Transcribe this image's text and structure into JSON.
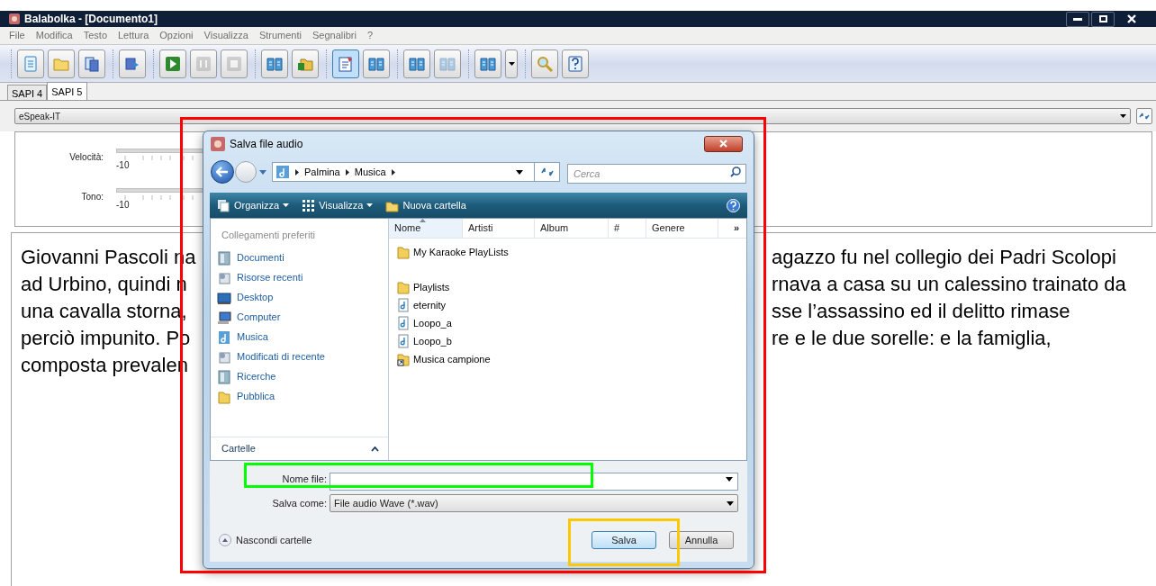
{
  "window": {
    "title": "Balabolka - [Documento1]"
  },
  "menu": [
    "File",
    "Modifica",
    "Testo",
    "Lettura",
    "Opzioni",
    "Visualizza",
    "Strumenti",
    "Segnalibri",
    "?"
  ],
  "toolbar": [
    [
      {
        "kind": "document",
        "pressed": false,
        "disabled": false
      },
      {
        "kind": "folder",
        "pressed": false,
        "disabled": false
      },
      {
        "kind": "pages",
        "pressed": false,
        "disabled": false
      }
    ],
    [
      {
        "kind": "export",
        "pressed": false,
        "disabled": false
      }
    ],
    [
      {
        "kind": "play",
        "pressed": false,
        "disabled": false
      },
      {
        "kind": "pause",
        "pressed": false,
        "disabled": true
      },
      {
        "kind": "stop",
        "pressed": false,
        "disabled": true
      }
    ],
    [
      {
        "kind": "book",
        "pressed": false,
        "disabled": false
      },
      {
        "kind": "folderbook",
        "pressed": false,
        "disabled": false
      }
    ],
    [
      {
        "kind": "clipboard",
        "pressed": true,
        "disabled": false
      },
      {
        "kind": "book",
        "pressed": false,
        "disabled": false
      }
    ],
    [
      {
        "kind": "book",
        "pressed": false,
        "disabled": false
      },
      {
        "kind": "book",
        "pressed": false,
        "disabled": true
      }
    ],
    [
      {
        "kind": "book",
        "pressed": false,
        "disabled": false
      },
      {
        "kind": "dropdown",
        "pressed": false,
        "disabled": false
      }
    ],
    [
      {
        "kind": "magnifier",
        "pressed": false,
        "disabled": false
      },
      {
        "kind": "help",
        "pressed": false,
        "disabled": false
      }
    ]
  ],
  "engine_tabs": [
    {
      "label": "SAPI 4",
      "selected": false
    },
    {
      "label": "SAPI 5",
      "selected": true
    }
  ],
  "voice": {
    "value": "eSpeak-IT"
  },
  "sliders": [
    {
      "label": "Velocità:",
      "min": "-10"
    },
    {
      "label": "Tono:",
      "min": "-10"
    }
  ],
  "text_lines": [
    {
      "left": "Giovanni Pascoli na",
      "right": "agazzo fu nel collegio dei Padri Scolopi"
    },
    {
      "left": "ad Urbino, quindi n",
      "right": "rnava a casa su un calessino trainato da"
    },
    {
      "left": "una cavalla storna,",
      "right": "sse l’assassino ed il delitto rimase"
    },
    {
      "left": "perciò impunito. Po",
      "right": "re e le due sorelle: e la famiglia,"
    },
    {
      "left": "composta prevalen"
    }
  ],
  "dialog": {
    "title": "Salva file audio",
    "breadcrumb": [
      "Palmina",
      "Musica"
    ],
    "search": {
      "placeholder": "Cerca"
    },
    "commands": [
      {
        "label": "Organizza",
        "kind": "menu"
      },
      {
        "label": "Visualizza",
        "kind": "views"
      },
      {
        "label": "Nuova cartella",
        "kind": "newfolder"
      }
    ],
    "favorites_title": "Collegamenti preferiti",
    "favorites": [
      {
        "label": "Documenti",
        "kind": "documents"
      },
      {
        "label": "Risorse recenti",
        "kind": "recent"
      },
      {
        "label": "Desktop",
        "kind": "desktop"
      },
      {
        "label": "Computer",
        "kind": "computer"
      },
      {
        "label": "Musica",
        "kind": "music"
      },
      {
        "label": "Modificati di recente",
        "kind": "recent"
      },
      {
        "label": "Ricerche",
        "kind": "documents"
      },
      {
        "label": "Pubblica",
        "kind": "folder"
      }
    ],
    "folders_label": "Cartelle",
    "columns": [
      {
        "label": "Nome",
        "sorted": true
      },
      {
        "label": "Artisti",
        "sorted": false
      },
      {
        "label": "Album",
        "sorted": false
      },
      {
        "label": "#",
        "sorted": false
      },
      {
        "label": "Genere",
        "sorted": false
      }
    ],
    "more_columns": "»",
    "files": [
      {
        "name": "My Karaoke PlayLists",
        "kind": "folder"
      },
      {
        "name": "Playlists",
        "kind": "folder"
      },
      {
        "name": "eternity",
        "kind": "audio"
      },
      {
        "name": "Loopo_a",
        "kind": "audio"
      },
      {
        "name": "Loopo_b",
        "kind": "audio"
      },
      {
        "name": "Musica campione",
        "kind": "shortcut"
      }
    ],
    "filename_label": "Nome file:",
    "filetype": {
      "label": "Salva come:",
      "value": "File audio Wave (*.wav)"
    },
    "hide_folders": "Nascondi cartelle",
    "buttons": [
      {
        "label": "Salva",
        "default": true
      },
      {
        "label": "Annulla",
        "default": false
      }
    ]
  }
}
